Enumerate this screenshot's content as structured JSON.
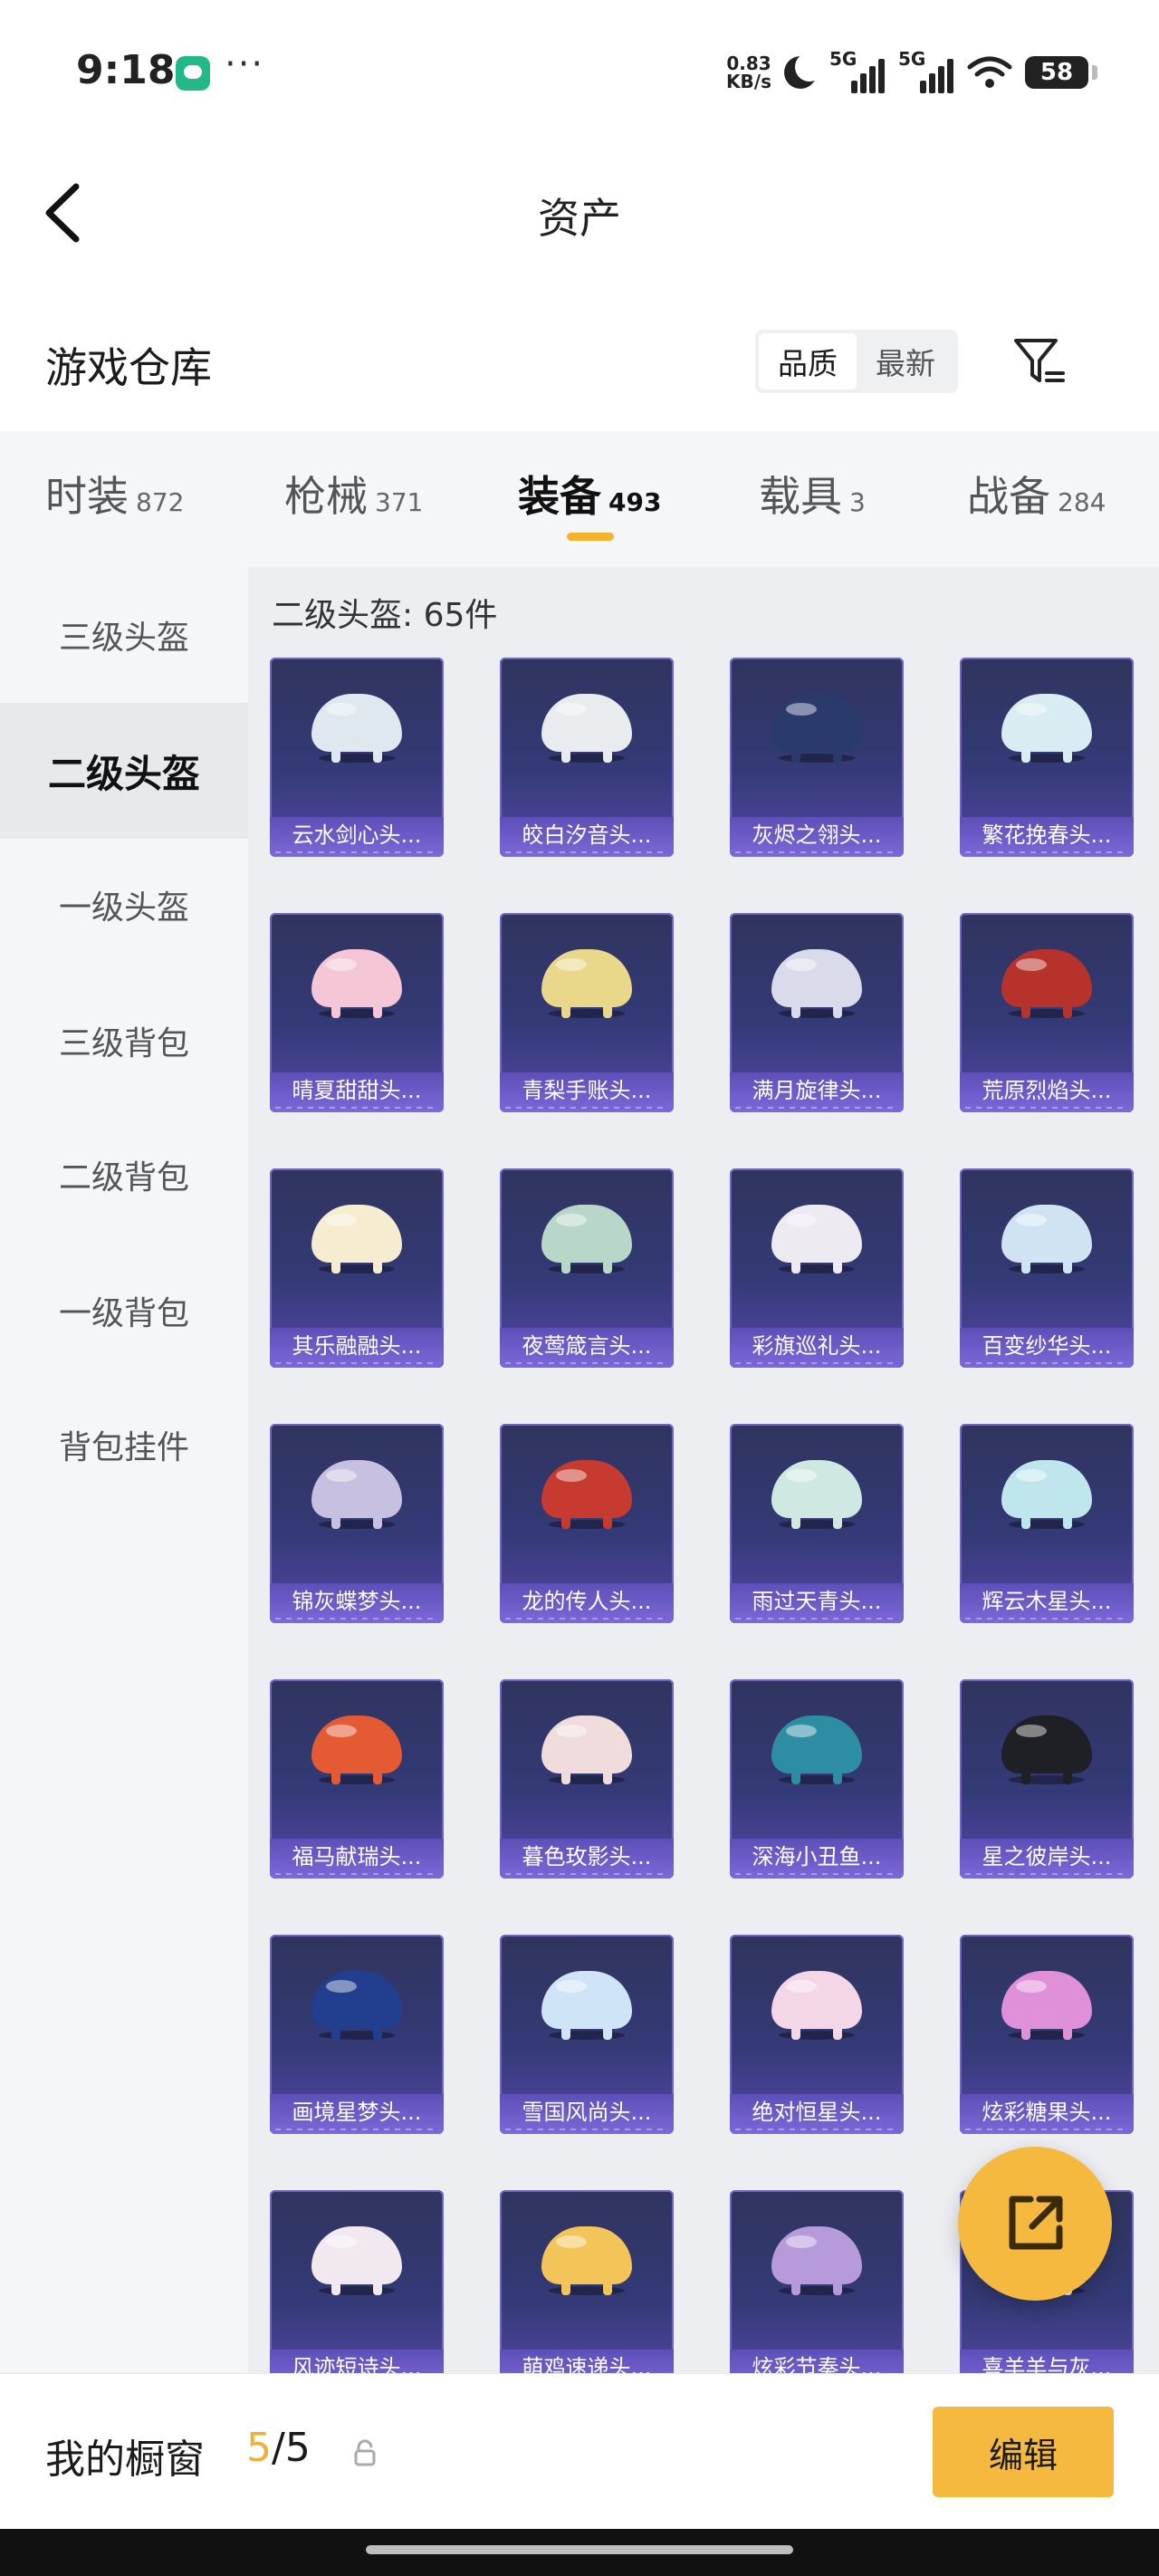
{
  "status_bar": {
    "time": "9:18",
    "more": "···",
    "net_speed_value": "0.83",
    "net_speed_unit": "KB/s",
    "signal_1": "5G",
    "signal_2": "5G",
    "battery": "58"
  },
  "header": {
    "title": "资产",
    "back_icon": "chevron-left-icon"
  },
  "section": {
    "title": "游戏仓库",
    "sort_options": [
      "品质",
      "最新"
    ],
    "sort_selected": "品质",
    "filter_icon": "filter-funnel-icon"
  },
  "tabs": [
    {
      "label": "时装",
      "count": "872"
    },
    {
      "label": "枪械",
      "count": "371"
    },
    {
      "label": "装备",
      "count": "493",
      "active": true
    },
    {
      "label": "载具",
      "count": "3"
    },
    {
      "label": "战备",
      "count": "284"
    }
  ],
  "sidebar": [
    {
      "label": "三级头盔"
    },
    {
      "label": "二级头盔",
      "active": true
    },
    {
      "label": "一级头盔"
    },
    {
      "label": "三级背包"
    },
    {
      "label": "二级背包"
    },
    {
      "label": "一级背包"
    },
    {
      "label": "背包挂件"
    }
  ],
  "grid": {
    "count_label": "二级头盔: 65件",
    "items": [
      {
        "name": "云水剑心头...",
        "color": "#dfe8ef"
      },
      {
        "name": "皎白汐音头...",
        "color": "#e9ecef"
      },
      {
        "name": "灰烬之翎头...",
        "color": "#2a3a6a"
      },
      {
        "name": "繁花挽春头...",
        "color": "#d8ecf1"
      },
      {
        "name": "晴夏甜甜头...",
        "color": "#f4c6d6"
      },
      {
        "name": "青梨手账头...",
        "color": "#e9d889"
      },
      {
        "name": "满月旋律头...",
        "color": "#dadbea"
      },
      {
        "name": "荒原烈焰头...",
        "color": "#b8322c"
      },
      {
        "name": "其乐融融头...",
        "color": "#f6ecd0"
      },
      {
        "name": "夜莺箴言头...",
        "color": "#b9d7c8"
      },
      {
        "name": "彩旗巡礼头...",
        "color": "#eeeaf2"
      },
      {
        "name": "百变纱华头...",
        "color": "#cfe3f3"
      },
      {
        "name": "锦灰蝶梦头...",
        "color": "#c7c0e0"
      },
      {
        "name": "龙的传人头...",
        "color": "#c73a2f"
      },
      {
        "name": "雨过天青头...",
        "color": "#cfe9e2"
      },
      {
        "name": "辉云木星头...",
        "color": "#bfe6ec"
      },
      {
        "name": "福马献瑞头...",
        "color": "#e35a33"
      },
      {
        "name": "暮色玫影头...",
        "color": "#f0dcdc"
      },
      {
        "name": "深海小丑鱼...",
        "color": "#2d8ea3"
      },
      {
        "name": "星之彼岸头...",
        "color": "#1f1f26"
      },
      {
        "name": "画境星梦头...",
        "color": "#213e8f"
      },
      {
        "name": "雪国风尚头...",
        "color": "#cfe4f6"
      },
      {
        "name": "绝对恒星头...",
        "color": "#f3d7e6"
      },
      {
        "name": "炫彩糖果头...",
        "color": "#e08fd9"
      },
      {
        "name": "风迹短诗头...",
        "color": "#f1e9ef"
      },
      {
        "name": "萌鸡速递头...",
        "color": "#f3c558"
      },
      {
        "name": "炫彩节奏头...",
        "color": "#b79ad9"
      },
      {
        "name": "喜羊羊与灰...",
        "color": "#f1efe8"
      }
    ]
  },
  "fab": {
    "icon": "share-external-icon"
  },
  "bottom_bar": {
    "label": "我的橱窗",
    "current": "5",
    "separator_total": "/5",
    "lock_icon": "lock-icon",
    "edit_label": "编辑"
  },
  "colors": {
    "accent": "#f4b93e",
    "card_bg": "#333a76",
    "card_label_bg": "#7c68d8"
  }
}
